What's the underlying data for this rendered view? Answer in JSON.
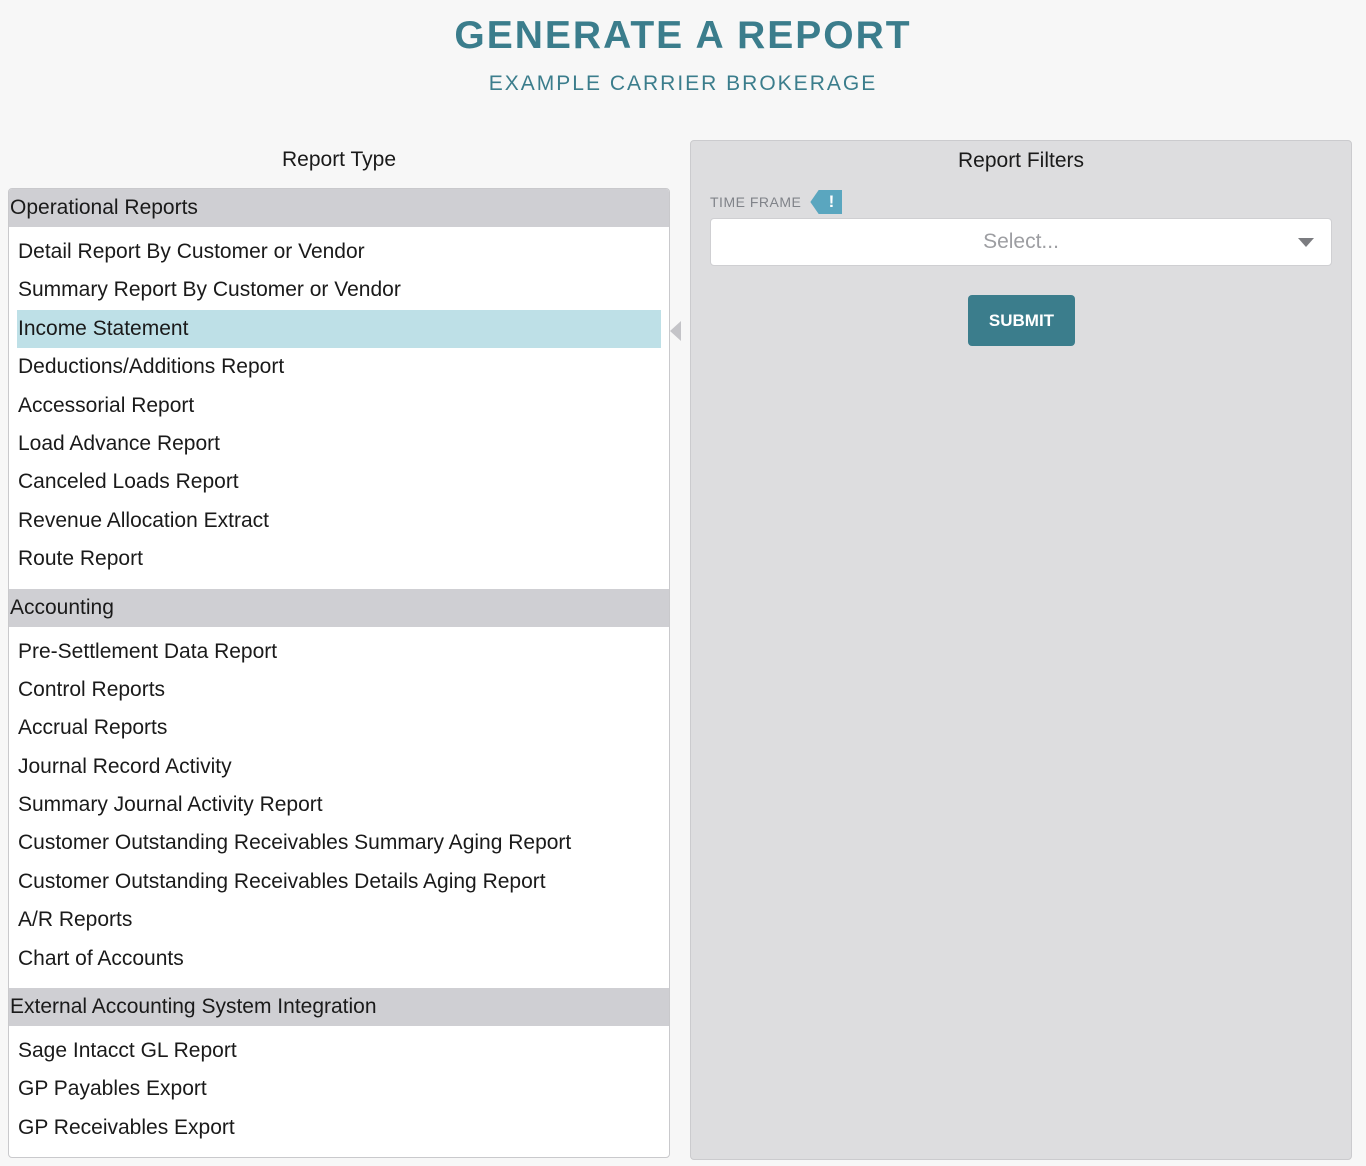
{
  "header": {
    "title": "GENERATE A REPORT",
    "subtitle": "EXAMPLE CARRIER BROKERAGE"
  },
  "report_type": {
    "title": "Report Type",
    "groups": [
      {
        "label": "Operational Reports",
        "items": [
          "Detail Report By Customer or Vendor",
          "Summary Report By Customer or Vendor",
          "Income Statement",
          "Deductions/Additions Report",
          "Accessorial Report",
          "Load Advance Report",
          "Canceled Loads Report",
          "Revenue Allocation Extract",
          "Route Report"
        ]
      },
      {
        "label": "Accounting",
        "items": [
          "Pre-Settlement Data Report",
          "Control Reports",
          "Accrual Reports",
          "Journal Record Activity",
          "Summary Journal Activity Report",
          "Customer Outstanding Receivables Summary Aging Report",
          "Customer Outstanding Receivables Details Aging Report",
          "A/R Reports",
          "Chart of Accounts"
        ]
      },
      {
        "label": "External Accounting System Integration",
        "items": [
          "Sage Intacct GL Report",
          "GP Payables Export",
          "GP Receivables Export"
        ]
      }
    ],
    "selected": "Income Statement"
  },
  "report_filters": {
    "title": "Report Filters",
    "time_frame": {
      "label": "TIME FRAME",
      "alert_icon": "!",
      "placeholder": "Select..."
    },
    "submit_label": "SUBMIT"
  },
  "colors": {
    "accent": "#3b7d8c",
    "selected_row": "#bee0e7",
    "group_header": "#cfcfd3",
    "alert": "#5aa6bf"
  }
}
